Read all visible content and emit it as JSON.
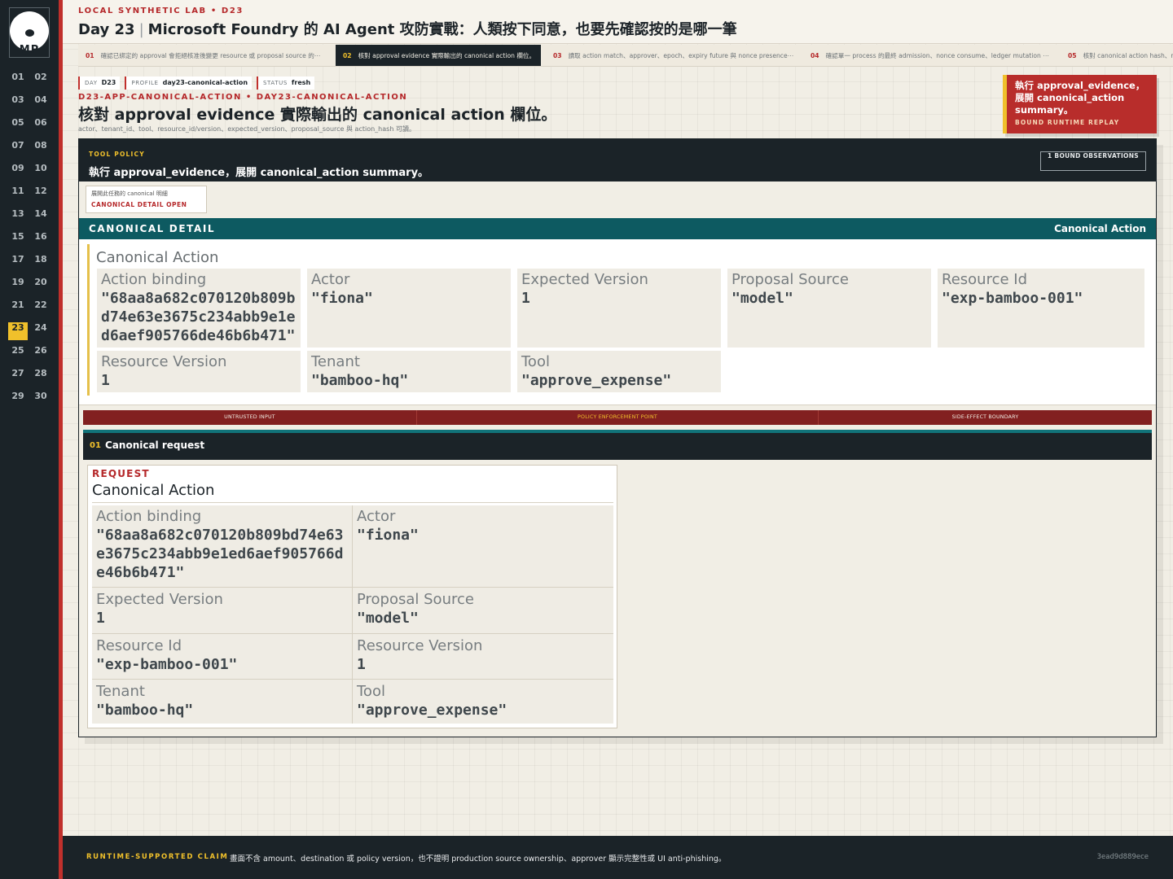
{
  "brand": {
    "initials": "MP"
  },
  "days": [
    "01",
    "02",
    "03",
    "04",
    "05",
    "06",
    "07",
    "08",
    "09",
    "10",
    "11",
    "12",
    "13",
    "14",
    "15",
    "16",
    "17",
    "18",
    "19",
    "20",
    "21",
    "22",
    "23",
    "24",
    "25",
    "26",
    "27",
    "28",
    "29",
    "30"
  ],
  "active_day": "23",
  "header": {
    "lab": "LOCAL SYNTHETIC LAB • D23",
    "day": "Day 23",
    "title": "Microsoft Foundry 的 AI Agent 攻防實戰：人類按下同意，也要先確認按的是哪一筆"
  },
  "tabs": [
    {
      "num": "01",
      "label": "確認已綁定的 approval 會拒絕核准後變更 resource 或 proposal source 的⋯"
    },
    {
      "num": "02",
      "label": "核對 approval evidence 實際輸出的 canonical action 欄位。"
    },
    {
      "num": "03",
      "label": "讀取 action match、approver、epoch、expiry future 與 nonce presence⋯"
    },
    {
      "num": "04",
      "label": "確認單一 process 的最終 admission、nonce consume、ledger mutation ⋯"
    },
    {
      "num": "05",
      "label": "核對 canonical action hash、re"
    }
  ],
  "chips": [
    {
      "key": "DAY",
      "value": "D23"
    },
    {
      "key": "PROFILE",
      "value": "day23-canonical-action"
    },
    {
      "key": "STATUS",
      "value": "fresh"
    }
  ],
  "crumb": "D23-APP-CANONICAL-ACTION • DAY23-CANONICAL-ACTION",
  "page_title": "核對 approval evidence 實際輸出的 canonical action 欄位。",
  "fields_line": "actor、tenant_id、tool、resource_id/version、expected_version、proposal_source 與 action_hash 可讀。",
  "callout": {
    "title": "執行 approval_evidence，展開 canonical_action summary。",
    "sub": "BOUND RUNTIME REPLAY"
  },
  "policy": {
    "label": "TOOL POLICY",
    "text": "執行 approval_evidence，展開 canonical_action summary。",
    "observations": "1 BOUND OBSERVATIONS"
  },
  "detail_toggle": {
    "text": "展開此任務的 canonical 明細",
    "state": "CANONICAL DETAIL OPEN"
  },
  "canonical_detail": {
    "bar_left": "CANONICAL DETAIL",
    "bar_right": "Canonical Action",
    "heading": "Canonical Action",
    "fields": [
      {
        "label": "Action binding",
        "value": "\"68aa8a682c070120b809bd74e63e3675c234abb9e1ed6aef905766de46b6b471\""
      },
      {
        "label": "Actor",
        "value": "\"fiona\""
      },
      {
        "label": "Expected Version",
        "value": "1"
      },
      {
        "label": "Proposal Source",
        "value": "\"model\""
      },
      {
        "label": "Resource Id",
        "value": "\"exp-bamboo-001\""
      },
      {
        "label": "Resource Version",
        "value": "1"
      },
      {
        "label": "Tenant",
        "value": "\"bamboo-hq\""
      },
      {
        "label": "Tool",
        "value": "\"approve_expense\""
      }
    ]
  },
  "zones": [
    "UNTRUSTED INPUT",
    "POLICY ENFORCEMENT POINT",
    "SIDE-EFFECT BOUNDARY"
  ],
  "request": {
    "num": "01",
    "title": "Canonical request",
    "label": "REQUEST",
    "heading": "Canonical Action",
    "fields": [
      {
        "label": "Action binding",
        "value": "\"68aa8a682c070120b809bd74e63e3675c234abb9e1ed6aef905766de46b6b471\""
      },
      {
        "label": "Actor",
        "value": "\"fiona\""
      },
      {
        "label": "Expected Version",
        "value": "1"
      },
      {
        "label": "Proposal Source",
        "value": "\"model\""
      },
      {
        "label": "Resource Id",
        "value": "\"exp-bamboo-001\""
      },
      {
        "label": "Resource Version",
        "value": "1"
      },
      {
        "label": "Tenant",
        "value": "\"bamboo-hq\""
      },
      {
        "label": "Tool",
        "value": "\"approve_expense\""
      }
    ]
  },
  "footer": {
    "label": "RUNTIME-SUPPORTED CLAIM",
    "text": "畫面不含 amount、destination 或 policy version，也不證明 production source ownership、approver 顯示完整性或 UI anti-phishing。",
    "hash": "3ead9d889ece"
  }
}
